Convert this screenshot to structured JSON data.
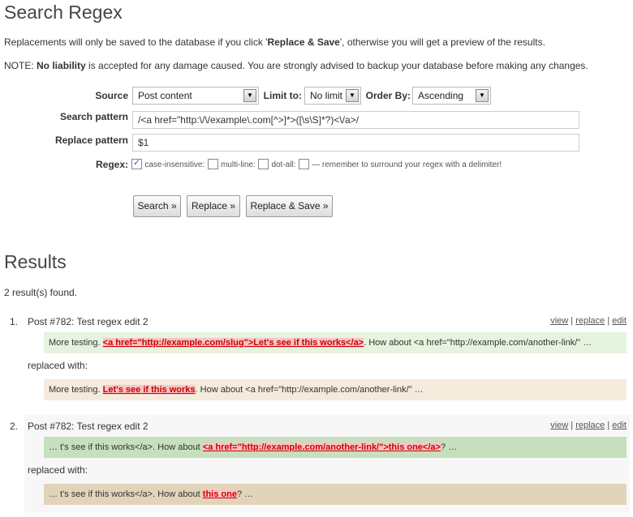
{
  "page": {
    "title": "Search Regex",
    "intro_prefix": "Replacements will only be saved to the database if you click '",
    "intro_bold": "Replace & Save",
    "intro_suffix": "', otherwise you will get a preview of the results.",
    "note_prefix": "NOTE: ",
    "note_bold": "No liability",
    "note_suffix": " is accepted for any damage caused. You are strongly advised to backup your database before making any changes."
  },
  "form": {
    "source_label": "Source",
    "source_value": "Post content",
    "limit_label": "Limit to:",
    "limit_value": "No limit",
    "order_label": "Order By:",
    "order_value": "Ascending",
    "search_label": "Search pattern",
    "search_value": "/<a href=\"http:\\/\\/example\\.com[^>]*>([\\s\\S]*?)<\\/a>/",
    "replace_label": "Replace pattern",
    "replace_value": "$1",
    "regex_label": "Regex:",
    "opt_case": "case-insensitive:",
    "opt_multiline": "multi-line:",
    "opt_dotall": "dot-all:",
    "opt_note": "— remember to surround your regex with a delimiter!",
    "case_checked": true
  },
  "buttons": {
    "search": "Search »",
    "replace": "Replace »",
    "replace_save": "Replace & Save »"
  },
  "results": {
    "heading": "Results",
    "count_text": "2 result(s) found.",
    "replaced_with": "replaced with:",
    "link_view": "view",
    "link_replace": "replace",
    "link_edit": "edit",
    "sep": "|",
    "items": [
      {
        "num": "1.",
        "title": "Post #782: Test regex edit 2",
        "orig_pre": "More testing. ",
        "orig_match": "<a href=\"http://example.com/slug\">Let's see if this works</a>",
        "orig_post": ". How about <a href=\"http://example.com/another-link/\" …",
        "rep_pre": "More testing. ",
        "rep_match": "Let's see if this works",
        "rep_post": ". How about <a href=\"http://example.com/another-link/\" …"
      },
      {
        "num": "2.",
        "title": "Post #782: Test regex edit 2",
        "orig_pre": "… t's see if this works</a>. How about ",
        "orig_match": "<a href=\"http://example.com/another-link/\">this one</a>",
        "orig_post": "? …",
        "rep_pre": "… t's see if this works</a>. How about ",
        "rep_match": "this one",
        "rep_post": "? …"
      }
    ]
  }
}
